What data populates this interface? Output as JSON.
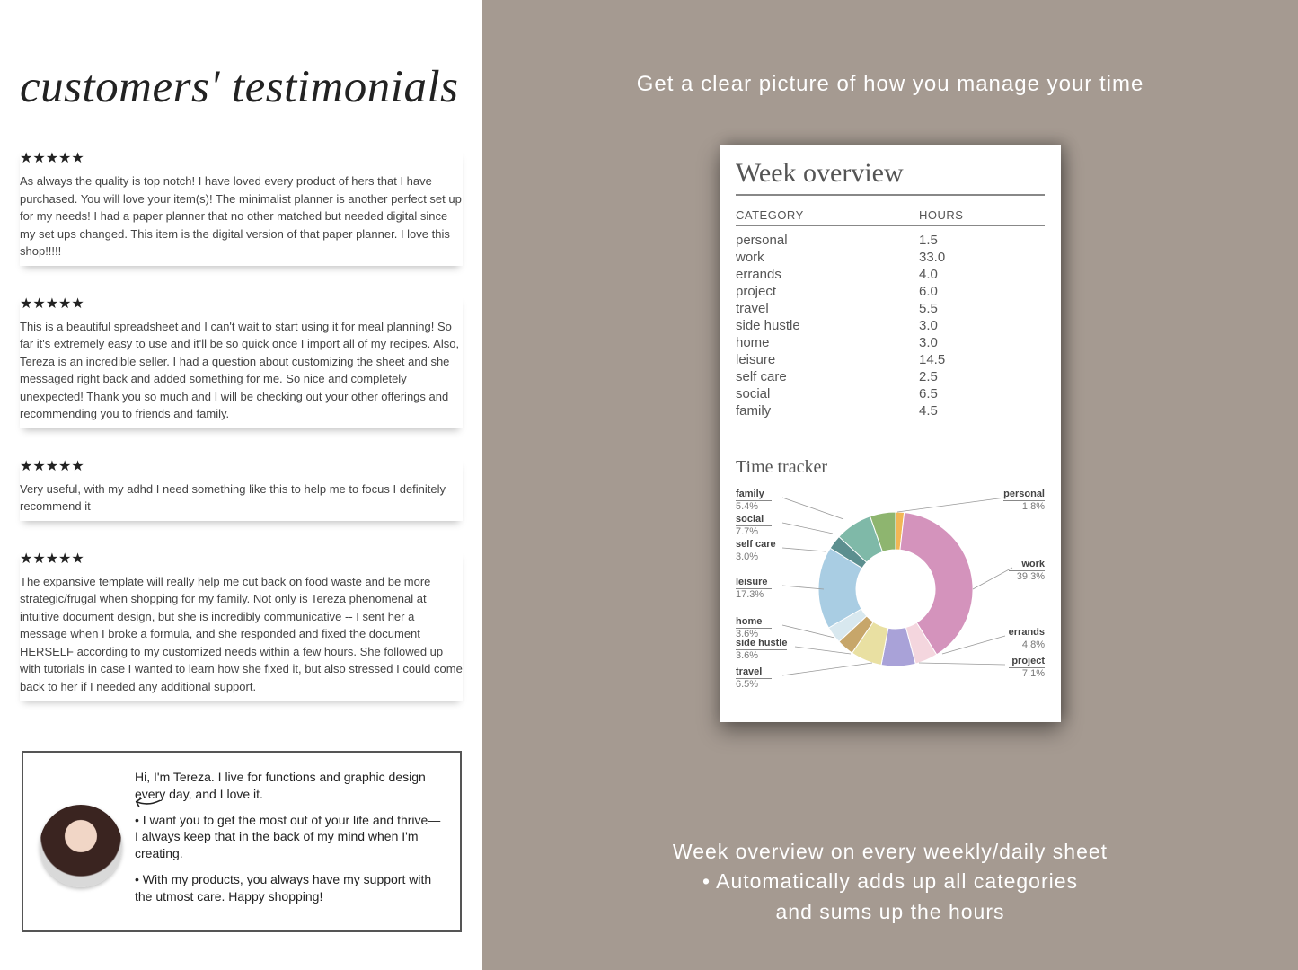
{
  "left": {
    "title": "customers' testimonials",
    "reviews": [
      {
        "stars": "★★★★★",
        "text": "As always the quality is top notch! I have loved every product of hers that I have purchased. You will love your item(s)! The minimalist planner is another perfect set up for my needs! I had a paper planner that no other matched but needed digital since my set ups changed. This item is the digital version of that paper planner. I love this shop!!!!!"
      },
      {
        "stars": "★★★★★",
        "text": "This is a beautiful spreadsheet and I can't wait to start using it for meal planning! So far it's extremely easy to use and it'll be so quick once I import all of my recipes. Also, Tereza is an incredible seller. I had a question about customizing the sheet and she messaged right back and added something for me. So nice and completely unexpected! Thank you so much and I will be checking out your other offerings and recommending you to friends and family."
      },
      {
        "stars": "★★★★★",
        "text": "Very useful, with my adhd I need something like this to help me to focus I definitely recommend it"
      },
      {
        "stars": "★★★★★",
        "text": "The expansive template will really help me cut back on food waste and be more strategic/frugal when shopping for my family. Not only is Tereza phenomenal at intuitive document design, but she is incredibly communicative -- I sent her a message when I broke a formula, and she responded and fixed the document HERSELF according to my customized needs within a few hours. She followed up with tutorials in case I wanted to learn how she fixed it, but also stressed I could come back to her if I needed any additional support."
      }
    ],
    "intro": {
      "line1": "Hi, I'm Tereza. I live for functions and graphic design every day, and I love it.",
      "line2": "• I want you to get the most out of your life and thrive—I always keep that in the back of my mind when I'm creating.",
      "line3": "• With my products, you always have my support with the utmost care. Happy shopping!"
    }
  },
  "right": {
    "top": "Get a clear picture of how you manage your time",
    "sheet_title": "Week overview",
    "col_category": "CATEGORY",
    "col_hours": "HOURS",
    "rows": [
      {
        "cat": "personal",
        "hr": "1.5"
      },
      {
        "cat": "work",
        "hr": "33.0"
      },
      {
        "cat": "errands",
        "hr": "4.0"
      },
      {
        "cat": "project",
        "hr": "6.0"
      },
      {
        "cat": "travel",
        "hr": "5.5"
      },
      {
        "cat": "side hustle",
        "hr": "3.0"
      },
      {
        "cat": "home",
        "hr": "3.0"
      },
      {
        "cat": "leisure",
        "hr": "14.5"
      },
      {
        "cat": "self care",
        "hr": "2.5"
      },
      {
        "cat": "social",
        "hr": "6.5"
      },
      {
        "cat": "family",
        "hr": "4.5"
      }
    ],
    "tracker_title": "Time tracker",
    "labels": {
      "family": {
        "name": "family",
        "pct": "5.4%"
      },
      "social": {
        "name": "social",
        "pct": "7.7%"
      },
      "selfcare": {
        "name": "self care",
        "pct": "3.0%"
      },
      "leisure": {
        "name": "leisure",
        "pct": "17.3%"
      },
      "home": {
        "name": "home",
        "pct": "3.6%"
      },
      "sidehustle": {
        "name": "side hustle",
        "pct": "3.6%"
      },
      "travel": {
        "name": "travel",
        "pct": "6.5%"
      },
      "personal": {
        "name": "personal",
        "pct": "1.8%"
      },
      "work": {
        "name": "work",
        "pct": "39.3%"
      },
      "errands": {
        "name": "errands",
        "pct": "4.8%"
      },
      "project": {
        "name": "project",
        "pct": "7.1%"
      }
    },
    "bottom_line1": "Week overview on every weekly/daily sheet",
    "bottom_line2": "• Automatically adds up all categories",
    "bottom_line3": "and sums up the hours"
  },
  "chart_data": {
    "type": "pie",
    "title": "Time tracker",
    "series": [
      {
        "name": "personal",
        "value": 1.5,
        "pct": 1.8,
        "color": "#f2b755"
      },
      {
        "name": "work",
        "value": 33.0,
        "pct": 39.3,
        "color": "#d493bc"
      },
      {
        "name": "errands",
        "value": 4.0,
        "pct": 4.8,
        "color": "#f4d6de"
      },
      {
        "name": "project",
        "value": 6.0,
        "pct": 7.1,
        "color": "#a9a2d8"
      },
      {
        "name": "travel",
        "value": 5.5,
        "pct": 6.5,
        "color": "#e9e0a2"
      },
      {
        "name": "side hustle",
        "value": 3.0,
        "pct": 3.6,
        "color": "#c7a66a"
      },
      {
        "name": "home",
        "value": 3.0,
        "pct": 3.6,
        "color": "#d8e8ef"
      },
      {
        "name": "leisure",
        "value": 14.5,
        "pct": 17.3,
        "color": "#a9cde3"
      },
      {
        "name": "self care",
        "value": 2.5,
        "pct": 3.0,
        "color": "#5c8f8f"
      },
      {
        "name": "social",
        "value": 6.5,
        "pct": 7.7,
        "color": "#7fb9a8"
      },
      {
        "name": "family",
        "value": 4.5,
        "pct": 5.4,
        "color": "#8eb56f"
      }
    ]
  }
}
